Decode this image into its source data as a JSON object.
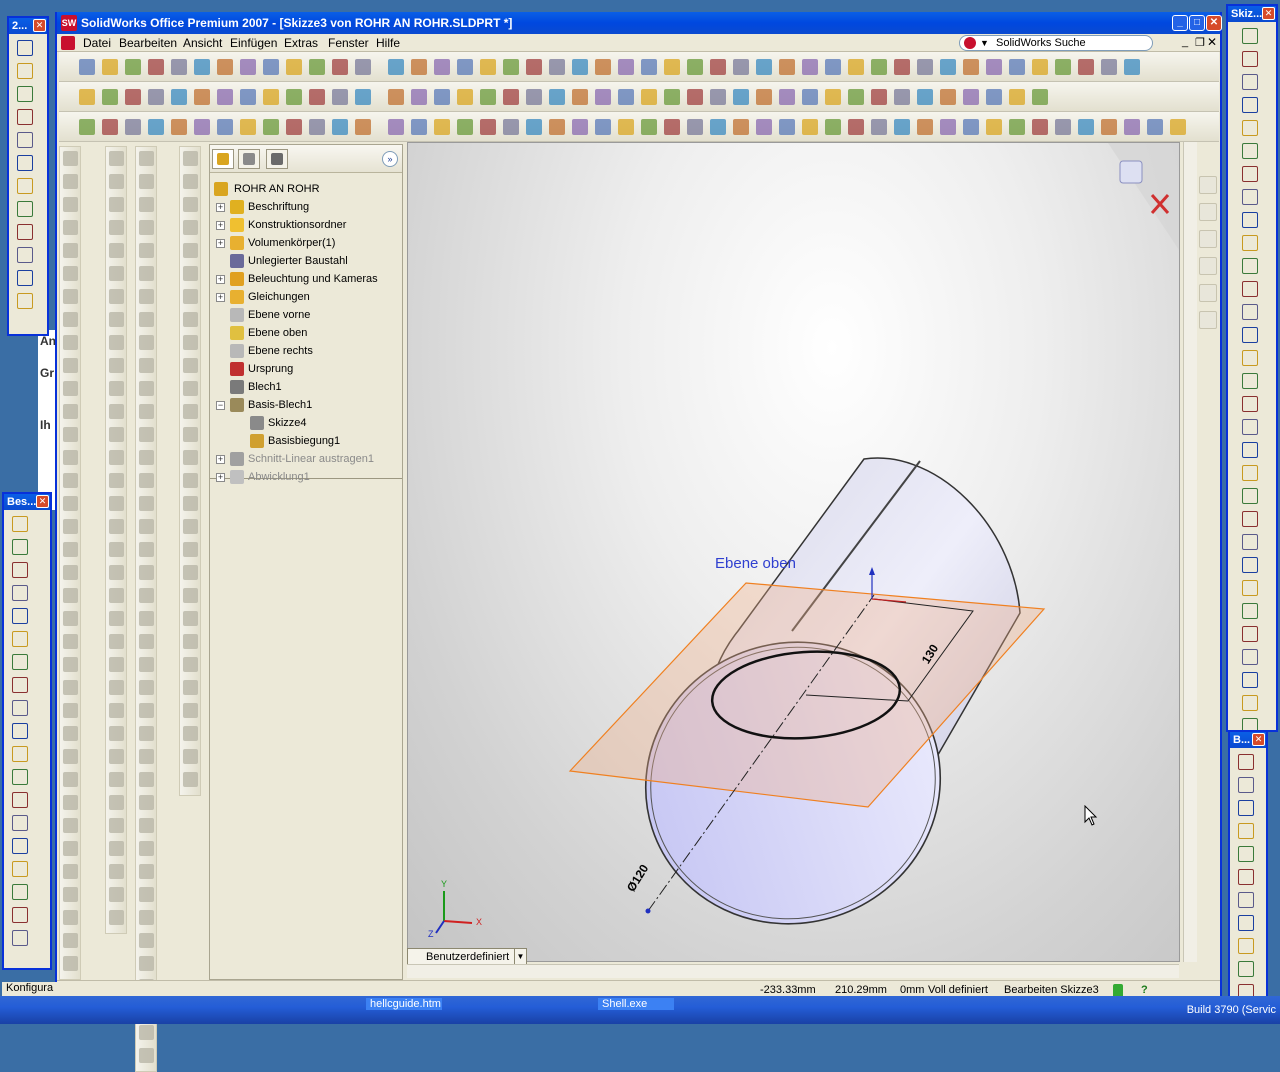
{
  "window": {
    "title": "SolidWorks Office Premium 2007 - [Skizze3 von ROHR AN ROHR.SLDPRT *]",
    "logo_text": "SW"
  },
  "menu": {
    "items": [
      "Datei",
      "Bearbeiten",
      "Ansicht",
      "Einfügen",
      "Extras",
      "Fenster",
      "Hilfe"
    ],
    "search_label": "SolidWorks Suche"
  },
  "tree": {
    "root": "ROHR AN ROHR",
    "items": [
      {
        "label": "Beschriftung",
        "expand": "+",
        "color": "#e0b020"
      },
      {
        "label": "Konstruktionsordner",
        "expand": "+",
        "color": "#f0c030"
      },
      {
        "label": "Volumenkörper(1)",
        "expand": "+",
        "color": "#e8b030"
      },
      {
        "label": "Unlegierter Baustahl",
        "expand": "",
        "color": "#6a6a9a"
      },
      {
        "label": "Beleuchtung und Kameras",
        "expand": "+",
        "color": "#e0a020"
      },
      {
        "label": "Gleichungen",
        "expand": "+",
        "color": "#e8b030"
      },
      {
        "label": "Ebene vorne",
        "expand": "",
        "color": "#b8b8b8"
      },
      {
        "label": "Ebene oben",
        "expand": "",
        "color": "#e0c040"
      },
      {
        "label": "Ebene rechts",
        "expand": "",
        "color": "#b8b8b8"
      },
      {
        "label": "Ursprung",
        "expand": "",
        "color": "#c03030"
      },
      {
        "label": "Blech1",
        "expand": "",
        "color": "#7a7a7a"
      },
      {
        "label": "Basis-Blech1",
        "expand": "−",
        "color": "#9a8a5a"
      },
      {
        "label": "Skizze4",
        "expand": "",
        "color": "#8a8a8a"
      },
      {
        "label": "Basisbiegung1",
        "expand": "",
        "color": "#d0a030"
      },
      {
        "label": "Schnitt-Linear austragen1",
        "expand": "+",
        "color": "#a0a0a0"
      },
      {
        "label": "Abwicklung1",
        "expand": "+",
        "color": "#c0c0c0"
      }
    ]
  },
  "viewport": {
    "plane_label": "Ebene oben",
    "dim_length": "130",
    "dim_diameter": "Ø120",
    "triad_x": "X",
    "triad_y": "Y",
    "triad_z": "Z",
    "view_selector": "Benutzerdefiniert"
  },
  "status": {
    "x": "-233.33mm",
    "y": "210.29mm",
    "z": "0mm",
    "state": "Voll definiert",
    "mode": "Bearbeiten Skizze3",
    "help": "?"
  },
  "floating": {
    "left_top_title": "2...",
    "left_bottom_title": "Bes...",
    "right_top_title": "Skiz...",
    "right_bottom_title": "B..."
  },
  "taskbar": {
    "config_text": "Konfigura",
    "task1": "hellcguide.htm",
    "task2": "Shell.exe",
    "build": "Build 3790 (Servic"
  }
}
